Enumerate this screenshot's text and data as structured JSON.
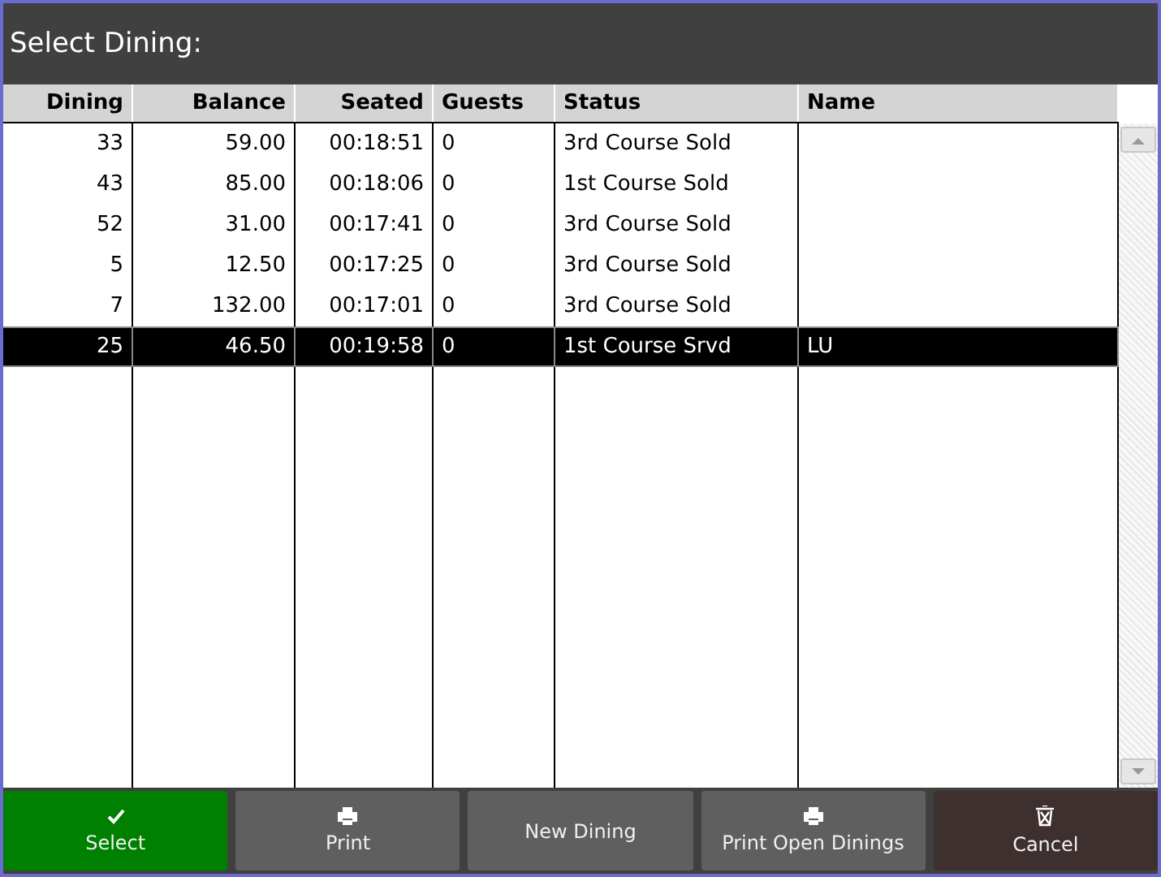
{
  "window": {
    "title": "Select Dining:"
  },
  "table": {
    "columns": [
      "Dining",
      "Balance",
      "Seated",
      "Guests",
      "Status",
      "Name"
    ],
    "rows": [
      {
        "cells": [
          "33",
          "59.00",
          "00:18:51",
          "0",
          "3rd Course Sold",
          ""
        ],
        "selected": false
      },
      {
        "cells": [
          "43",
          "85.00",
          "00:18:06",
          "0",
          "1st Course Sold",
          ""
        ],
        "selected": false
      },
      {
        "cells": [
          "52",
          "31.00",
          "00:17:41",
          "0",
          "3rd Course Sold",
          ""
        ],
        "selected": false
      },
      {
        "cells": [
          "5",
          "12.50",
          "00:17:25",
          "0",
          "3rd Course Sold",
          ""
        ],
        "selected": false
      },
      {
        "cells": [
          "7",
          "132.00",
          "00:17:01",
          "0",
          "3rd Course Sold",
          ""
        ],
        "selected": false
      },
      {
        "cells": [
          "25",
          "46.50",
          "00:19:58",
          "0",
          "1st Course Srvd",
          "LU"
        ],
        "selected": true
      }
    ]
  },
  "buttons": [
    {
      "label": "Select",
      "kind": "confirm"
    },
    {
      "label": "Print",
      "kind": "print"
    },
    {
      "label": "New Dining",
      "kind": "plain"
    },
    {
      "label": "Print Open Dinings",
      "kind": "print"
    },
    {
      "label": "Cancel",
      "kind": "cancel"
    }
  ]
}
